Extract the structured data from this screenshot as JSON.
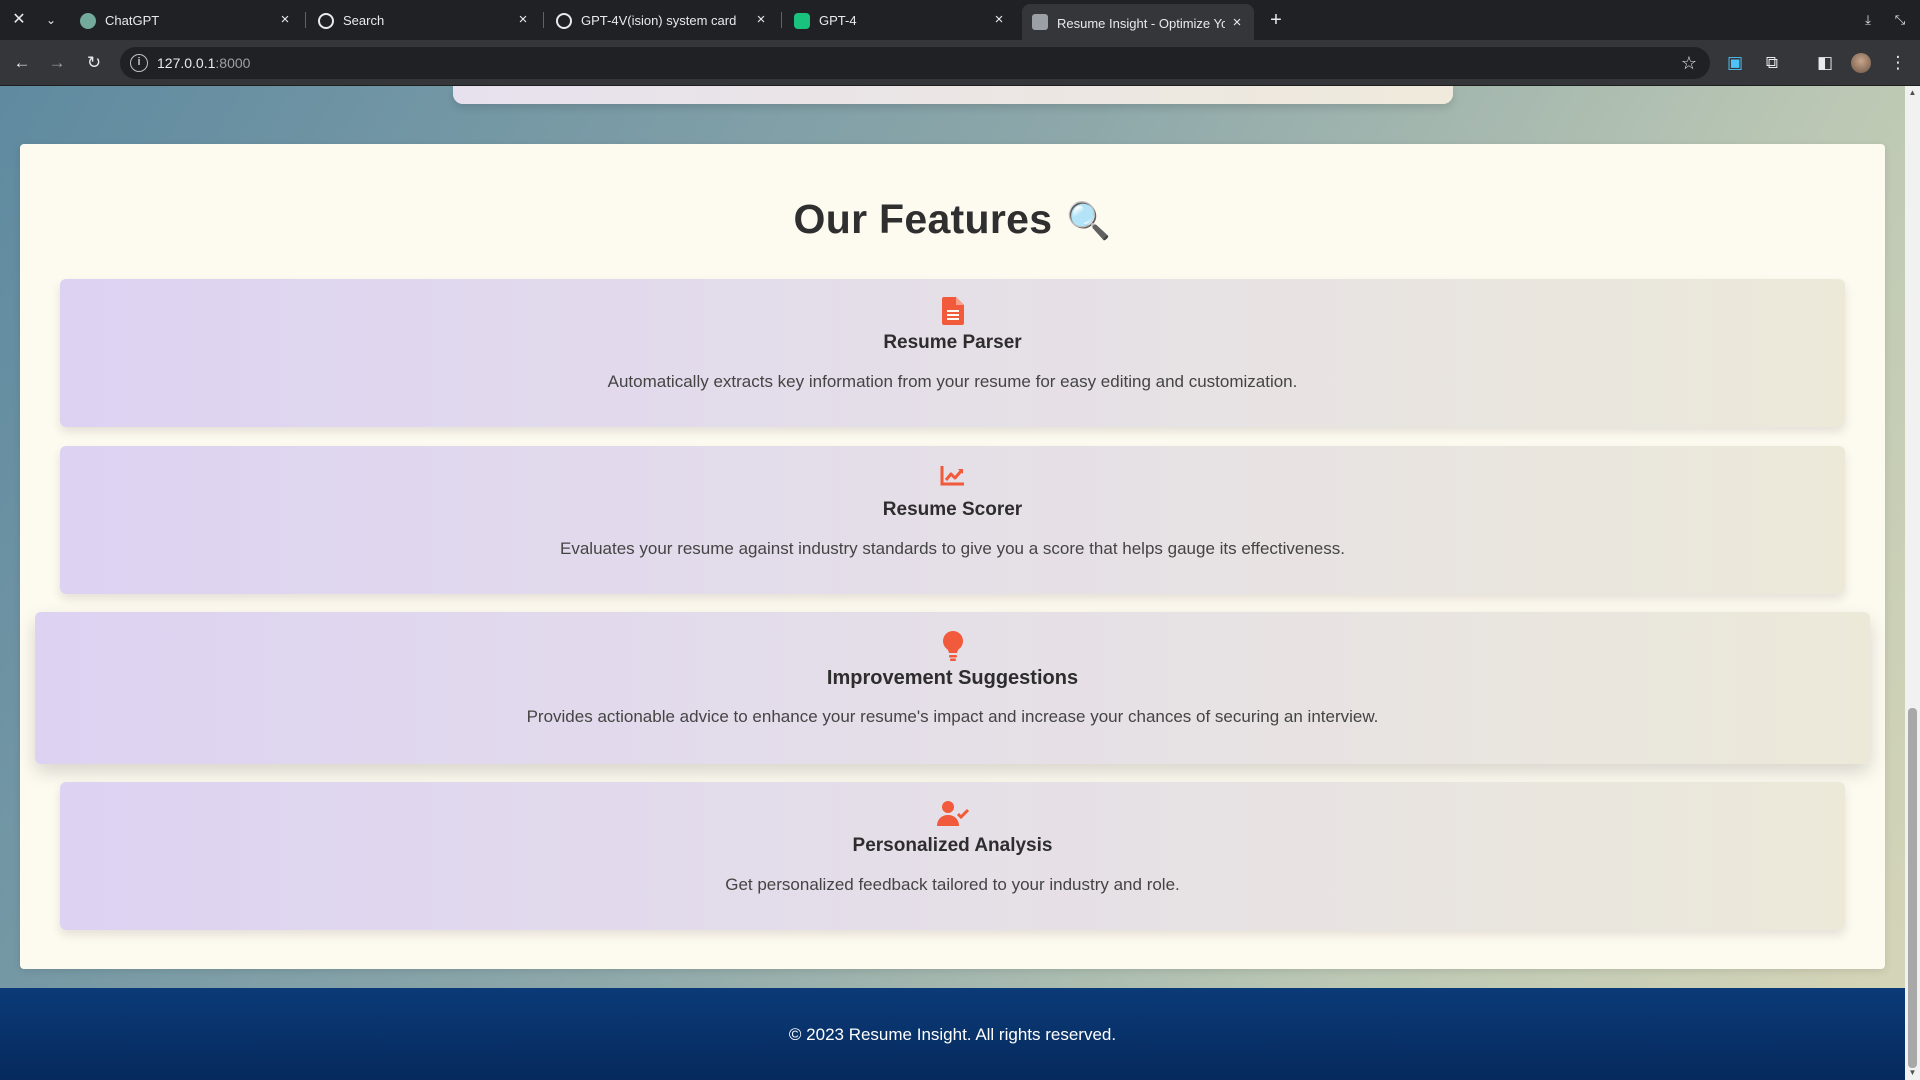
{
  "browser": {
    "tabs": [
      {
        "title": "ChatGPT",
        "favicon": "chatgpt-icon",
        "favicon_color": "#74aa9c"
      },
      {
        "title": "Search",
        "favicon": "openai-icon",
        "favicon_color": "#ffffff"
      },
      {
        "title": "GPT-4V(ision) system card",
        "favicon": "openai-icon",
        "favicon_color": "#ffffff"
      },
      {
        "title": "GPT-4",
        "favicon": "openai-green-icon",
        "favicon_color": "#19c37d"
      },
      {
        "title": "Resume Insight - Optimize You",
        "favicon": "resume-icon",
        "favicon_color": "#9aa0a6",
        "active": true
      }
    ],
    "url_host": "127.0.0.1",
    "url_port": ":8000"
  },
  "features": {
    "heading": "Our Features",
    "heading_icon": "🔍",
    "accent_color": "#f15a3a",
    "items": [
      {
        "icon": "document-icon",
        "title": "Resume Parser",
        "description": "Automatically extracts key information from your resume for easy editing and customization."
      },
      {
        "icon": "chart-line-icon",
        "title": "Resume Scorer",
        "description": "Evaluates your resume against industry standards to give you a score that helps gauge its effectiveness."
      },
      {
        "icon": "lightbulb-icon",
        "title": "Improvement Suggestions",
        "description": "Provides actionable advice to enhance your resume's impact and increase your chances of securing an interview."
      },
      {
        "icon": "user-check-icon",
        "title": "Personalized Analysis",
        "description": "Get personalized feedback tailored to your industry and role."
      }
    ]
  },
  "footer": {
    "copyright": "© 2023 Resume Insight. All rights reserved."
  }
}
